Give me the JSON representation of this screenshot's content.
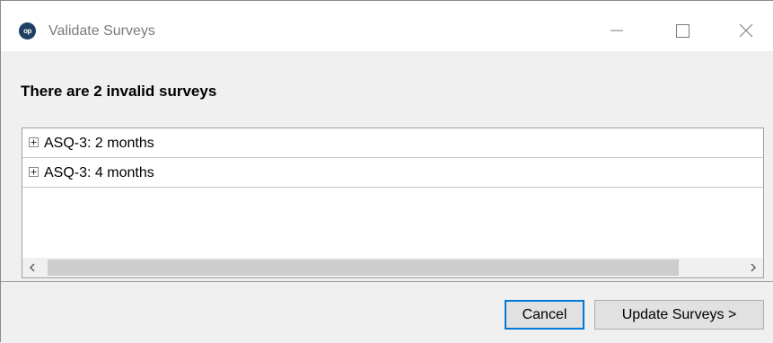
{
  "window": {
    "title": "Validate Surveys",
    "app_logo_text": "op",
    "controls": {
      "minimize_icon": "minimize-icon",
      "maximize_icon": "maximize-icon",
      "close_icon": "close-icon"
    }
  },
  "content": {
    "heading": "There are 2 invalid surveys",
    "tree": {
      "items": [
        {
          "label": "ASQ-3: 2 months",
          "expanded": false,
          "icon": "plus-box-icon"
        },
        {
          "label": "ASQ-3: 4 months",
          "expanded": false,
          "icon": "plus-box-icon"
        }
      ],
      "scrollbar": {
        "left_arrow": "<",
        "right_arrow": ">"
      }
    }
  },
  "footer": {
    "cancel_label": "Cancel",
    "update_label": "Update Surveys >"
  },
  "colors": {
    "focus_border": "#0078d7",
    "logo_background": "#1f3f63",
    "dialog_background": "#f0f0f0"
  }
}
